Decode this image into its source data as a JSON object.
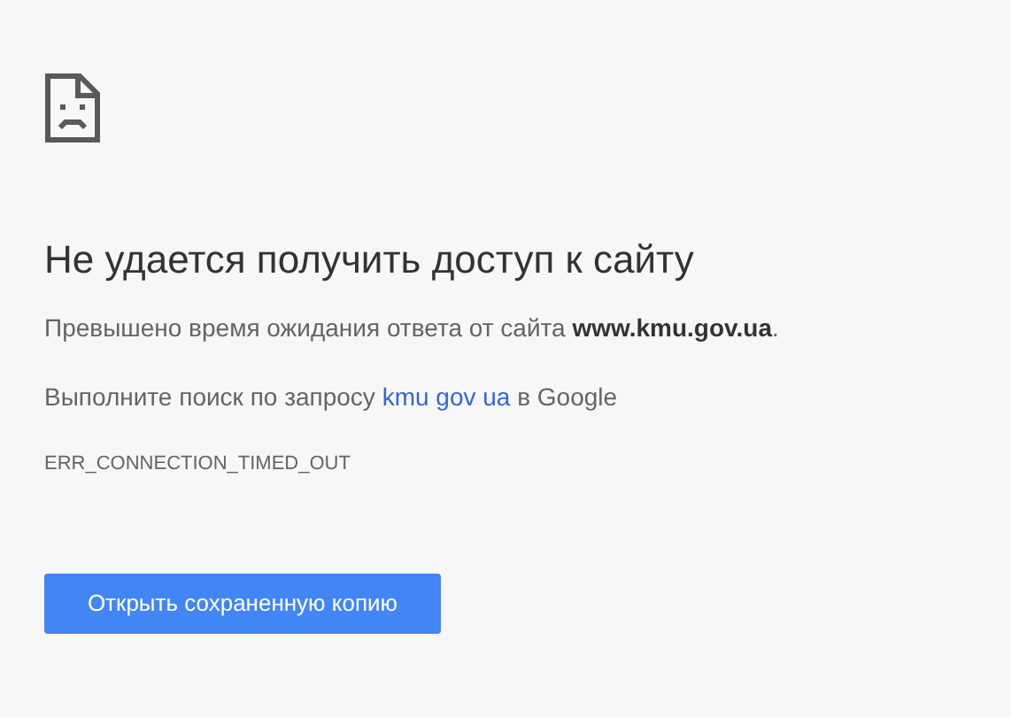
{
  "heading": "Не удается получить доступ к сайту",
  "message": "Превышено время ожидания ответа от сайта **www.kmu.gov.ua**.",
  "suggestion": {
    "before": "Выполните поиск по запросу",
    "link": "kmu gov ua",
    "after": "в Google"
  },
  "error_code": "ERR_CONNECTION_TIMED_OUT",
  "button": "Открыть сохраненную копию"
}
